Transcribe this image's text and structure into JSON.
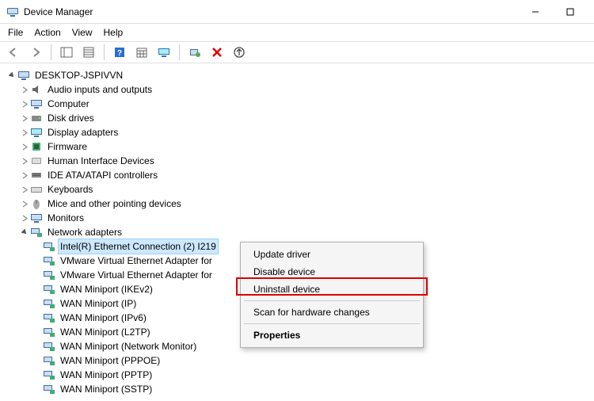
{
  "window": {
    "title": "Device Manager"
  },
  "menubar": {
    "file": "File",
    "action": "Action",
    "view": "View",
    "help": "Help"
  },
  "tree": {
    "root": "DESKTOP-JSPIVVN",
    "categories": [
      "Audio inputs and outputs",
      "Computer",
      "Disk drives",
      "Display adapters",
      "Firmware",
      "Human Interface Devices",
      "IDE ATA/ATAPI controllers",
      "Keyboards",
      "Mice and other pointing devices",
      "Monitors",
      "Network adapters"
    ],
    "network_adapters": [
      "Intel(R) Ethernet Connection (2) I219",
      "VMware Virtual Ethernet Adapter for",
      "VMware Virtual Ethernet Adapter for",
      "WAN Miniport (IKEv2)",
      "WAN Miniport (IP)",
      "WAN Miniport (IPv6)",
      "WAN Miniport (L2TP)",
      "WAN Miniport (Network Monitor)",
      "WAN Miniport (PPPOE)",
      "WAN Miniport (PPTP)",
      "WAN Miniport (SSTP)"
    ]
  },
  "context_menu": {
    "update_driver": "Update driver",
    "disable_device": "Disable device",
    "uninstall_device": "Uninstall device",
    "scan_hardware": "Scan for hardware changes",
    "properties": "Properties"
  }
}
